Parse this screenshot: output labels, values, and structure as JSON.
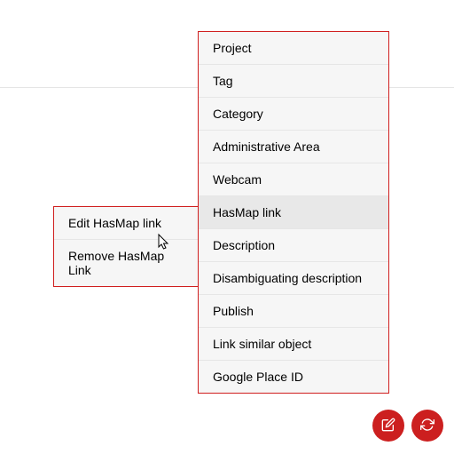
{
  "main_menu": {
    "items": [
      {
        "label": "Project"
      },
      {
        "label": "Tag"
      },
      {
        "label": "Category"
      },
      {
        "label": "Administrative Area"
      },
      {
        "label": "Webcam"
      },
      {
        "label": "HasMap link"
      },
      {
        "label": "Description"
      },
      {
        "label": "Disambiguating description"
      },
      {
        "label": "Publish"
      },
      {
        "label": "Link similar object"
      },
      {
        "label": "Google Place ID"
      }
    ],
    "highlighted_index": 5
  },
  "sub_menu": {
    "items": [
      {
        "label": "Edit HasMap link"
      },
      {
        "label": "Remove HasMap Link"
      }
    ]
  }
}
